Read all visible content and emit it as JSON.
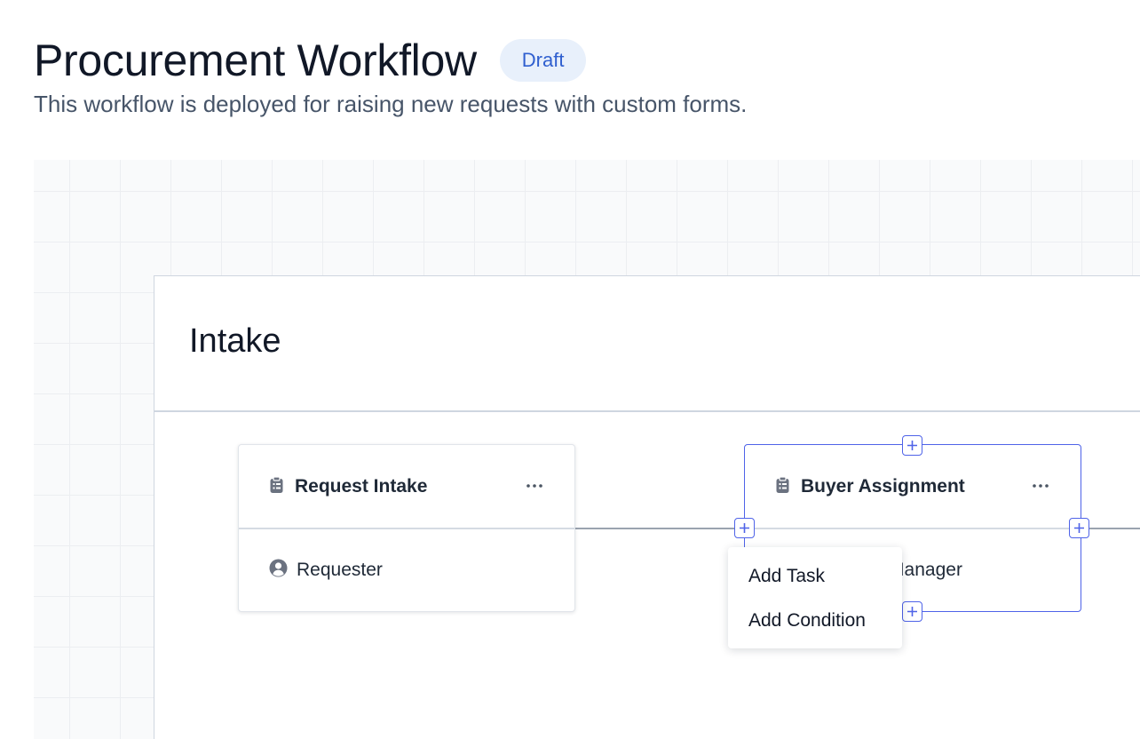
{
  "header": {
    "title": "Procurement Workflow",
    "status_badge": "Draft",
    "description": "This workflow is deployed for raising new requests with custom forms."
  },
  "stage": {
    "title": "Intake"
  },
  "nodes": [
    {
      "title": "Request Intake",
      "title_icon": "clipboard-icon",
      "assignee": "Requester",
      "assignee_icon": "user-circle-icon",
      "menu_icon": "ellipsis-icon"
    },
    {
      "title": "Buyer Assignment",
      "title_icon": "clipboard-icon",
      "assignee": "Procurement Manager",
      "assignee_visible_fragment": "nt Manager",
      "menu_icon": "ellipsis-icon",
      "selected": true
    }
  ],
  "context_menu": {
    "items": [
      {
        "label": "Add Task"
      },
      {
        "label": "Add Condition"
      }
    ]
  },
  "colors": {
    "accent": "#4f63e8",
    "badge_bg": "#e8f0fb",
    "badge_text": "#2f5fcf",
    "canvas_bg": "#f9fafb"
  }
}
